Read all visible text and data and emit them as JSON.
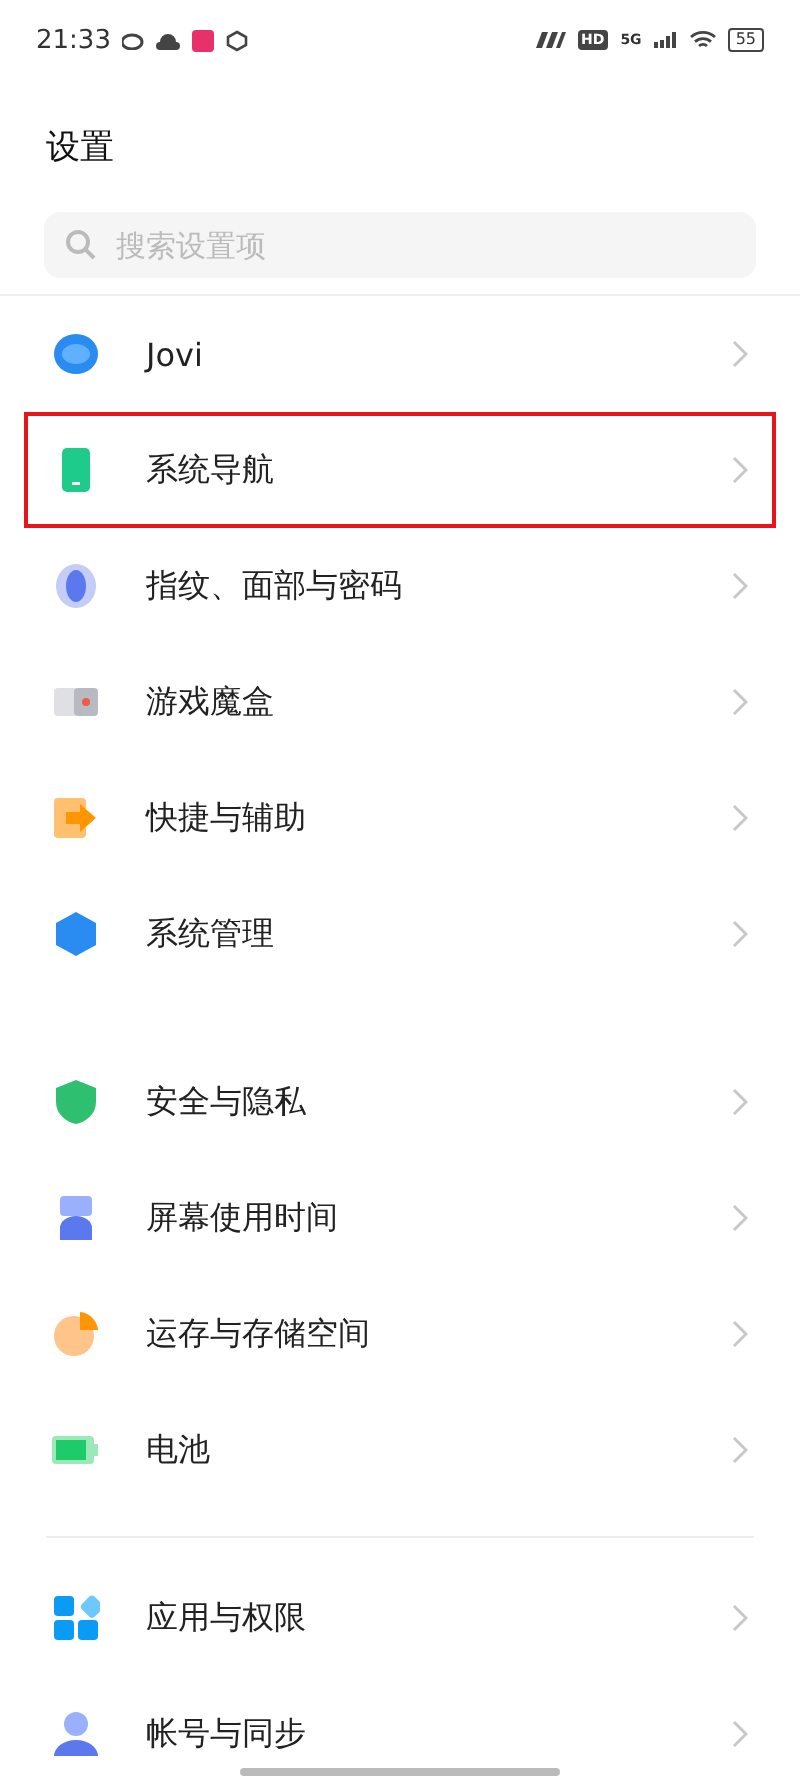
{
  "status_bar": {
    "time": "21:33",
    "hd": "HD",
    "network": "5G",
    "battery": "55"
  },
  "title": "设置",
  "search": {
    "placeholder": "搜索设置项"
  },
  "groups": [
    {
      "divider_before": false,
      "items": [
        {
          "label": "Jovi",
          "kind": "jovi",
          "highlighted": false
        },
        {
          "label": "系统导航",
          "kind": "phone",
          "highlighted": true
        },
        {
          "label": "指纹、面部与密码",
          "kind": "fingerprint",
          "highlighted": false
        },
        {
          "label": "游戏魔盒",
          "kind": "game",
          "highlighted": false
        },
        {
          "label": "快捷与辅助",
          "kind": "shortcut",
          "highlighted": false
        },
        {
          "label": "系统管理",
          "kind": "hexagon",
          "highlighted": false
        }
      ]
    },
    {
      "divider_before": false,
      "items": [
        {
          "label": "安全与隐私",
          "kind": "shield",
          "highlighted": false
        },
        {
          "label": "屏幕使用时间",
          "kind": "screentime",
          "highlighted": false
        },
        {
          "label": "运存与存储空间",
          "kind": "pie",
          "highlighted": false
        },
        {
          "label": "电池",
          "kind": "battery",
          "highlighted": false
        }
      ]
    },
    {
      "divider_before": true,
      "items": [
        {
          "label": "应用与权限",
          "kind": "apps",
          "highlighted": false
        },
        {
          "label": "帐号与同步",
          "kind": "person",
          "highlighted": false
        }
      ]
    }
  ]
}
